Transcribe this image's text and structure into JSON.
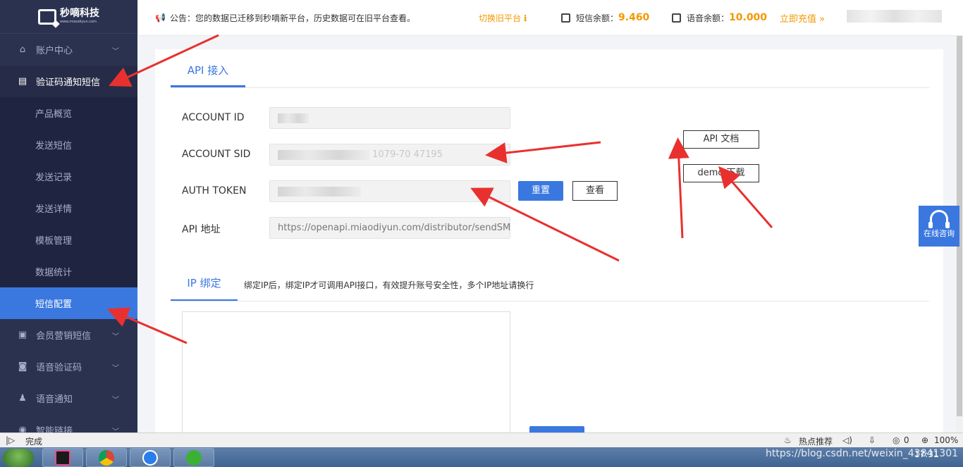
{
  "sidebar": {
    "logo_title": "秒嘀科技",
    "logo_sub": "www.miaodiyun.com",
    "menu": [
      {
        "label": "账户中心",
        "icon": "home-icon",
        "open": false
      },
      {
        "label": "验证码通知短信",
        "icon": "message-icon",
        "open": true
      }
    ],
    "sub_items": [
      "产品概览",
      "发送短信",
      "发送记录",
      "发送详情",
      "模板管理",
      "数据统计",
      "短信配置"
    ],
    "active_sub": "短信配置",
    "menu_bottom": [
      {
        "label": "会员营销短信",
        "icon": "marketing-icon"
      },
      {
        "label": "语音验证码",
        "icon": "voice-code-icon"
      },
      {
        "label": "语音通知",
        "icon": "voice-notify-icon"
      },
      {
        "label": "智能链接",
        "icon": "link-icon"
      }
    ]
  },
  "topbar": {
    "notice": "公告：您的数据已迁移到秒嘀新平台，历史数据可在旧平台查看。",
    "switch_old": "切换旧平台",
    "sms_label": "短信余额：",
    "sms_value": "9.460",
    "voice_label": "语音余额：",
    "voice_value": "10.000",
    "recharge": "立即充值 »"
  },
  "api": {
    "tab_label": "API 接入",
    "account_id_label": "ACCOUNT ID",
    "account_sid_label": "ACCOUNT SID",
    "account_sid_partial": "1079-70 47195",
    "auth_token_label": "AUTH TOKEN",
    "api_url_label": "API 地址",
    "api_url_value": "https://openapi.miaodiyun.com/distributor/sendSMS",
    "reset_button": "重置",
    "view_button": "查看",
    "doc_button": "API 文档",
    "demo_button": "demo 下载"
  },
  "ip": {
    "tab_label": "IP 绑定",
    "description": "绑定IP后，绑定IP才可调用API接口，有效提升账号安全性，多个IP地址请换行"
  },
  "consult": {
    "label": "在线咨询"
  },
  "statusbar": {
    "done": "完成",
    "hot": "热点推荐",
    "count": "0",
    "zoom": "100%"
  },
  "taskbar": {
    "watermark": "https://blog.csdn.net/weixin_43841301",
    "time": "17:31"
  },
  "colors": {
    "accent": "#3a78e0",
    "sidebar_bg": "#2b3250",
    "orange": "#f39800",
    "arrow": "#e8312f"
  }
}
